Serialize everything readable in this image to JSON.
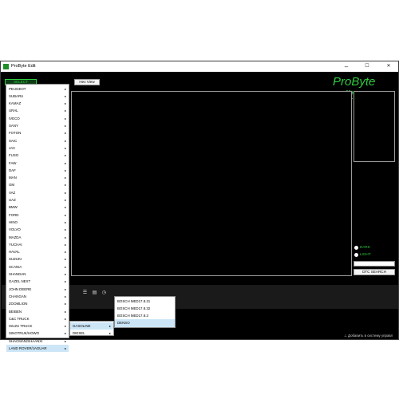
{
  "window": {
    "title": "ProByte Edit",
    "controls": [
      "–",
      "☐",
      "✕"
    ]
  },
  "toolbar": {
    "select_module": "SELECT MODULE",
    "hex_view": "Hex View"
  },
  "logo": "ProByte Edit",
  "brands": [
    "PEUGEOT",
    "SUBARU",
    "KAMAZ",
    "URAL",
    "IVECO",
    "SANY",
    "FOTON",
    "SAIC",
    "JAC",
    "FUSO",
    "FAW",
    "DAF",
    "MAN",
    "GM",
    "VAZ",
    "UAZ",
    "BMW",
    "FORD",
    "HINO",
    "VOLVO",
    "MAZDA",
    "YUCHAI",
    "HAVAL",
    "SUZUKI",
    "SCANIA",
    "SHANDAN",
    "GAZEL NEXT",
    "JOHN DEERE",
    "CHANGAN",
    "ZOOMLION",
    "BEIBEN",
    "C&C TRUCK",
    "ISUZU TRUCK",
    "SINOTRUK/HOWO",
    "SHACMAN/SHAANXI",
    "LAND ROVER/JAGUAR"
  ],
  "fuel_menu": [
    "GASOLINE",
    "DIESEL"
  ],
  "ecu_menu": [
    "BOSCH MED17.8.21",
    "BOSCH MED17.8.32",
    "BOSCH MED17.8.3",
    "DENSO"
  ],
  "theme": {
    "dark": "DARK",
    "light": "LIGHT"
  },
  "dtc_search": "DTC SEARCH",
  "status": {
    "message": "Добавить в систему управл"
  },
  "colors": {
    "accent": "#2ecc40",
    "background": "#000000",
    "highlight": "#cde6f7"
  }
}
